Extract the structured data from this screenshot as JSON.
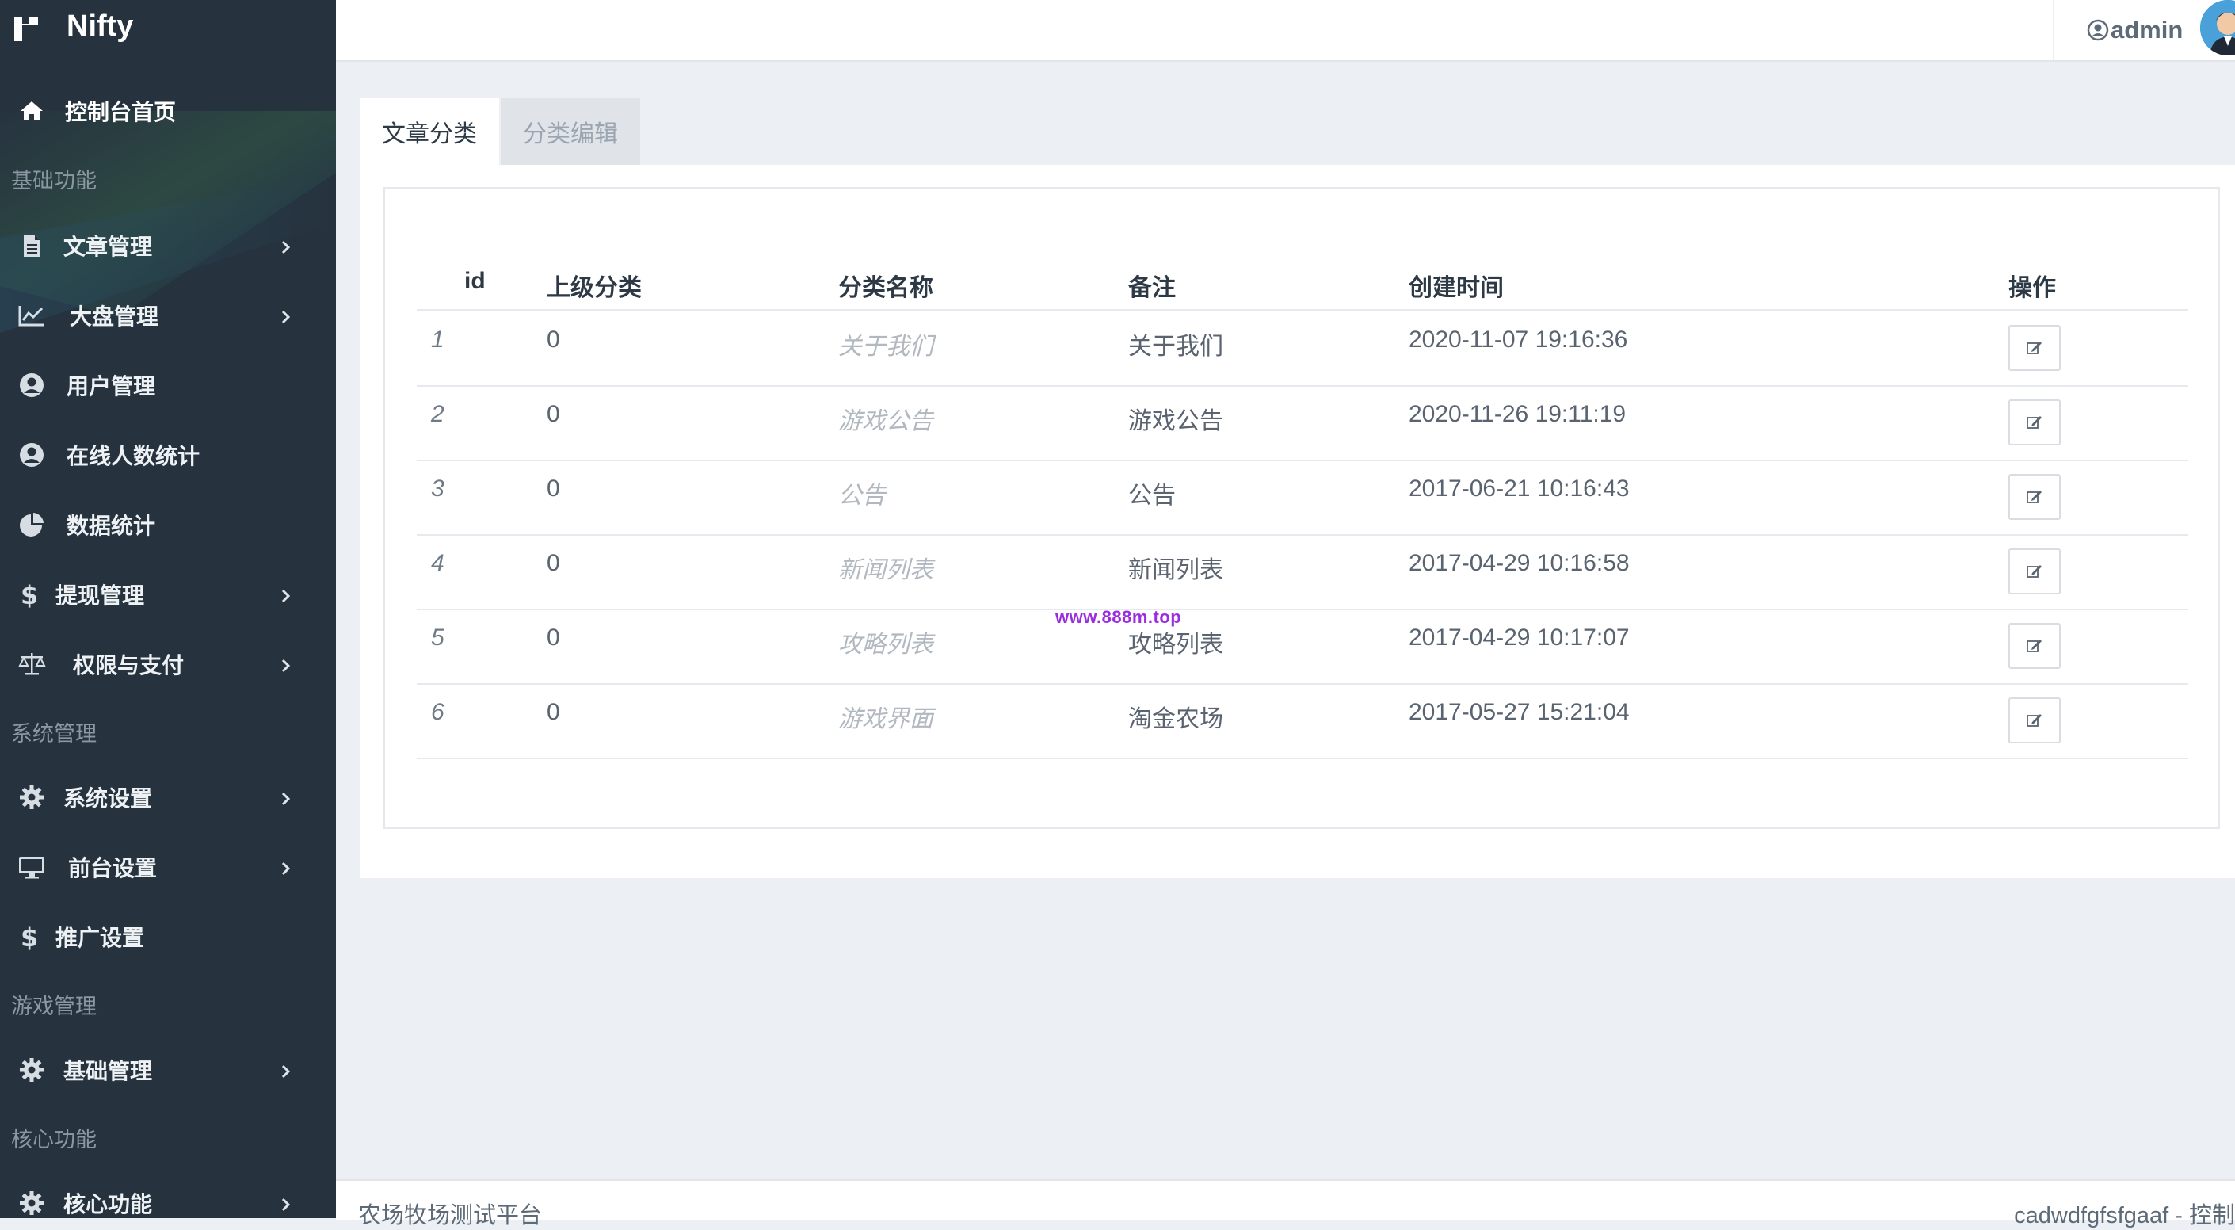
{
  "brand": {
    "name": "Nifty"
  },
  "sidebar": {
    "home": {
      "label": "控制台首页",
      "icon": "home-icon"
    },
    "sections": [
      {
        "header": "基础功能"
      },
      {
        "header": "系统管理"
      },
      {
        "header": "游戏管理"
      },
      {
        "header": "核心功能"
      }
    ],
    "items": [
      {
        "label": "文章管理",
        "icon": "file-icon",
        "expandable": true
      },
      {
        "label": "大盘管理",
        "icon": "line-chart-icon",
        "expandable": true
      },
      {
        "label": "用户管理",
        "icon": "user-circle-icon",
        "expandable": false
      },
      {
        "label": "在线人数统计",
        "icon": "user-circle-icon",
        "expandable": false
      },
      {
        "label": "数据统计",
        "icon": "pie-chart-icon",
        "expandable": false
      },
      {
        "label": "提现管理",
        "icon": "dollar-icon",
        "expandable": true
      },
      {
        "label": "权限与支付",
        "icon": "balance-scale-icon",
        "expandable": true
      },
      {
        "label": "系统设置",
        "icon": "gear-icon",
        "expandable": true
      },
      {
        "label": "前台设置",
        "icon": "desktop-icon",
        "expandable": true
      },
      {
        "label": "推广设置",
        "icon": "dollar-icon",
        "expandable": false
      },
      {
        "label": "基础管理",
        "icon": "gear-icon",
        "expandable": true
      },
      {
        "label": "核心功能",
        "icon": "gear-icon",
        "expandable": true
      }
    ]
  },
  "header": {
    "username": "admin"
  },
  "tabs": [
    {
      "label": "文章分类",
      "active": true
    },
    {
      "label": "分类编辑",
      "active": false
    }
  ],
  "table": {
    "columns": [
      "id",
      "上级分类",
      "分类名称",
      "备注",
      "创建时间",
      "操作"
    ],
    "rows": [
      {
        "id": "1",
        "parent": "0",
        "name": "关于我们",
        "remark": "关于我们",
        "created": "2020-11-07 19:16:36"
      },
      {
        "id": "2",
        "parent": "0",
        "name": "游戏公告",
        "remark": "游戏公告",
        "created": "2020-11-26 19:11:19"
      },
      {
        "id": "3",
        "parent": "0",
        "name": "公告",
        "remark": "公告",
        "created": "2017-06-21 10:16:43"
      },
      {
        "id": "4",
        "parent": "0",
        "name": "新闻列表",
        "remark": "新闻列表",
        "created": "2017-04-29 10:16:58"
      },
      {
        "id": "5",
        "parent": "0",
        "name": "攻略列表",
        "remark": "攻略列表",
        "created": "2017-04-29 10:17:07"
      },
      {
        "id": "6",
        "parent": "0",
        "name": "游戏界面",
        "remark": "淘金农场",
        "created": "2017-05-27 15:21:04"
      }
    ],
    "action_icon": "edit-icon"
  },
  "watermark": "www.888m.top",
  "footer": {
    "left": "农场牧场测试平台",
    "right": "cadwdfgfsfgaaf - 控制"
  },
  "colors": {
    "sidebar_bg": "#26333f",
    "content_bg": "#ecf0f5",
    "watermark": "#9b2de0"
  }
}
